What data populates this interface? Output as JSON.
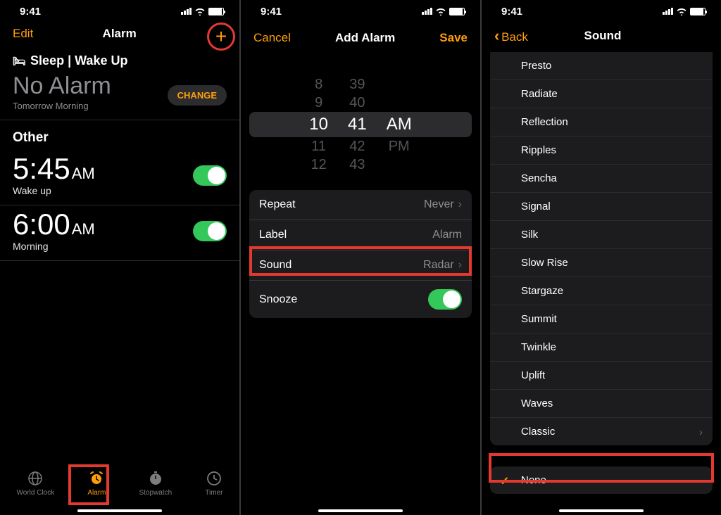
{
  "status": {
    "time": "9:41"
  },
  "screen1": {
    "edit": "Edit",
    "title": "Alarm",
    "sleep": {
      "header": "Sleep | Wake Up",
      "big": "No Alarm",
      "sub": "Tomorrow Morning",
      "change": "CHANGE"
    },
    "other": "Other",
    "alarms": [
      {
        "time": "5:45",
        "ampm": "AM",
        "label": "Wake up"
      },
      {
        "time": "6:00",
        "ampm": "AM",
        "label": "Morning"
      }
    ],
    "tabs": {
      "world": "World Clock",
      "alarm": "Alarm",
      "stopwatch": "Stopwatch",
      "timer": "Timer"
    }
  },
  "screen2": {
    "cancel": "Cancel",
    "title": "Add Alarm",
    "save": "Save",
    "wheel": {
      "hrs": [
        "8",
        "9",
        "10",
        "11",
        "12"
      ],
      "mins": [
        "39",
        "40",
        "41",
        "42",
        "43"
      ],
      "ap": [
        "AM",
        "PM"
      ]
    },
    "cells": {
      "repeat": "Repeat",
      "repeat_v": "Never",
      "label": "Label",
      "label_v": "Alarm",
      "sound": "Sound",
      "sound_v": "Radar",
      "snooze": "Snooze"
    }
  },
  "screen3": {
    "back": "Back",
    "title": "Sound",
    "sounds": [
      "Presto",
      "Radiate",
      "Reflection",
      "Ripples",
      "Sencha",
      "Signal",
      "Silk",
      "Slow Rise",
      "Stargaze",
      "Summit",
      "Twinkle",
      "Uplift",
      "Waves",
      "Classic"
    ],
    "none": "None"
  }
}
